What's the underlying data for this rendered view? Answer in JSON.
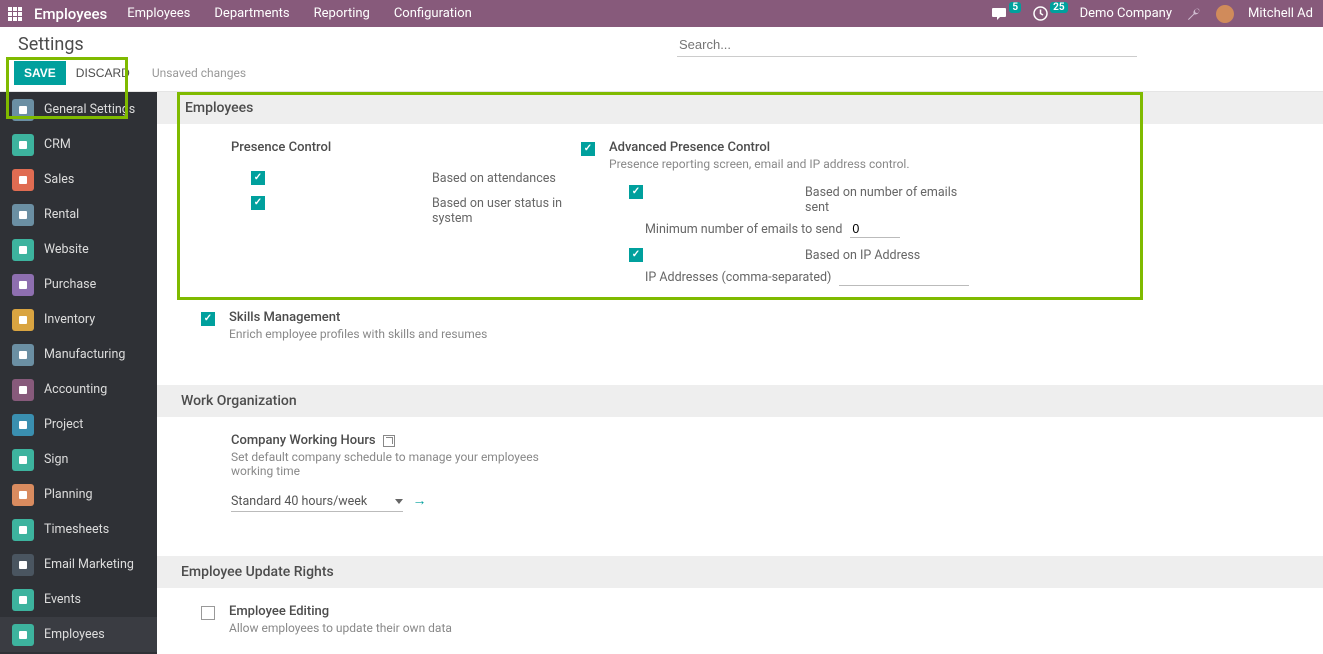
{
  "topbar": {
    "app_title": "Employees",
    "menu": [
      "Employees",
      "Departments",
      "Reporting",
      "Configuration"
    ],
    "msg_count": "5",
    "clock_count": "25",
    "company": "Demo Company",
    "user": "Mitchell Ad"
  },
  "subheader": {
    "title": "Settings",
    "save_label": "SAVE",
    "discard_label": "DISCARD",
    "unsaved": "Unsaved changes",
    "search_placeholder": "Search..."
  },
  "sidebar": {
    "items": [
      {
        "label": "General Settings",
        "color": "#6b8fa3"
      },
      {
        "label": "CRM",
        "color": "#3db39e"
      },
      {
        "label": "Sales",
        "color": "#e06c52"
      },
      {
        "label": "Rental",
        "color": "#6b8fa3"
      },
      {
        "label": "Website",
        "color": "#3db39e"
      },
      {
        "label": "Purchase",
        "color": "#8e6fb0"
      },
      {
        "label": "Inventory",
        "color": "#d9a441"
      },
      {
        "label": "Manufacturing",
        "color": "#6b8fa3"
      },
      {
        "label": "Accounting",
        "color": "#875a7b"
      },
      {
        "label": "Project",
        "color": "#3a8fb0"
      },
      {
        "label": "Sign",
        "color": "#3db39e"
      },
      {
        "label": "Planning",
        "color": "#d98b5f"
      },
      {
        "label": "Timesheets",
        "color": "#3db39e"
      },
      {
        "label": "Email Marketing",
        "color": "#4a5560"
      },
      {
        "label": "Events",
        "color": "#3db39e"
      },
      {
        "label": "Employees",
        "color": "#3db39e"
      }
    ]
  },
  "sections": {
    "employees": {
      "header": "Employees",
      "presence": {
        "title": "Presence Control",
        "opt1": "Based on attendances",
        "opt2": "Based on user status in system"
      },
      "advanced": {
        "title": "Advanced Presence Control",
        "desc": "Presence reporting screen, email and IP address control.",
        "opt1": "Based on number of emails sent",
        "min_emails_label": "Minimum number of emails to send",
        "min_emails_value": "0",
        "opt2": "Based on IP Address",
        "ip_label": "IP Addresses (comma-separated)"
      },
      "skills": {
        "title": "Skills Management",
        "desc": "Enrich employee profiles with skills and resumes"
      }
    },
    "work_org": {
      "header": "Work Organization",
      "hours_title": "Company Working Hours",
      "hours_desc": "Set default company schedule to manage your employees working time",
      "hours_value": "Standard 40 hours/week"
    },
    "update_rights": {
      "header": "Employee Update Rights",
      "editing_title": "Employee Editing",
      "editing_desc": "Allow employees to update their own data"
    }
  }
}
